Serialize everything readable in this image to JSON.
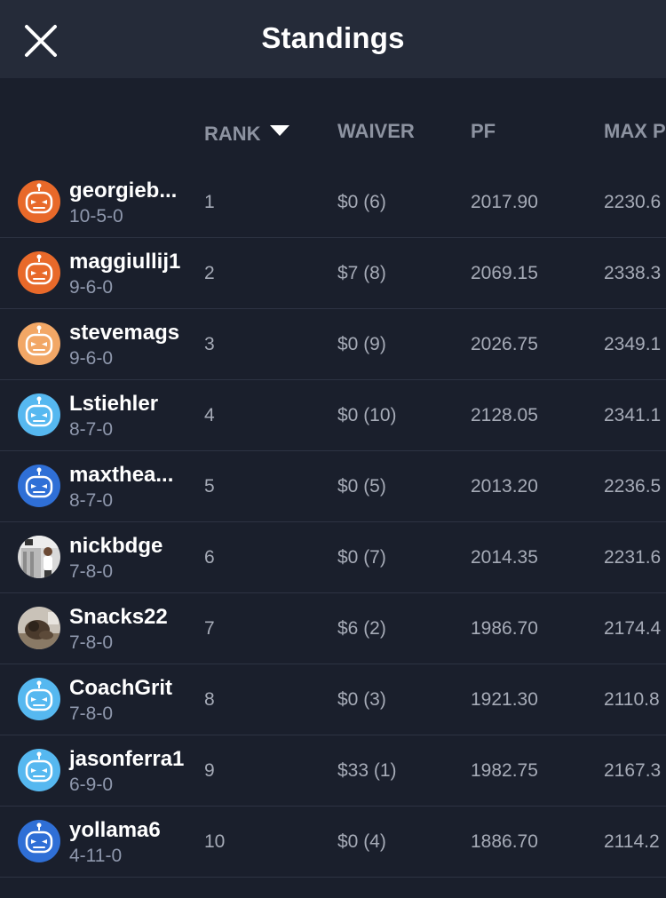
{
  "header": {
    "title": "Standings",
    "close_icon": "close-icon"
  },
  "columns": {
    "rank": "RANK",
    "waiver": "WAIVER",
    "pf": "PF",
    "max": "MAX P"
  },
  "colors": {
    "bot_orange": "#e8692a",
    "bot_peach": "#f2a766",
    "bot_lightblue": "#56b8f0",
    "bot_blue": "#2f6fd6"
  },
  "standings": [
    {
      "name": "georgieb...",
      "record": "10-5-0",
      "rank": "1",
      "waiver": "$0 (6)",
      "pf": "2017.90",
      "max": "2230.6",
      "avatar": "robot-orange"
    },
    {
      "name": "maggiullij1",
      "record": "9-6-0",
      "rank": "2",
      "waiver": "$7 (8)",
      "pf": "2069.15",
      "max": "2338.3",
      "avatar": "robot-orange"
    },
    {
      "name": "stevemags",
      "record": "9-6-0",
      "rank": "3",
      "waiver": "$0 (9)",
      "pf": "2026.75",
      "max": "2349.1",
      "avatar": "robot-peach"
    },
    {
      "name": "Lstiehler",
      "record": "8-7-0",
      "rank": "4",
      "waiver": "$0 (10)",
      "pf": "2128.05",
      "max": "2341.1",
      "avatar": "robot-lightblue"
    },
    {
      "name": "maxthea...",
      "record": "8-7-0",
      "rank": "5",
      "waiver": "$0 (5)",
      "pf": "2013.20",
      "max": "2236.5",
      "avatar": "robot-blue"
    },
    {
      "name": "nickbdge",
      "record": "7-8-0",
      "rank": "6",
      "waiver": "$0 (7)",
      "pf": "2014.35",
      "max": "2231.6",
      "avatar": "photo-person"
    },
    {
      "name": "Snacks22",
      "record": "7-8-0",
      "rank": "7",
      "waiver": "$6 (2)",
      "pf": "1986.70",
      "max": "2174.4",
      "avatar": "photo-dog"
    },
    {
      "name": "CoachGrit",
      "record": "7-8-0",
      "rank": "8",
      "waiver": "$0 (3)",
      "pf": "1921.30",
      "max": "2110.8",
      "avatar": "robot-lightblue"
    },
    {
      "name": "jasonferra1",
      "record": "6-9-0",
      "rank": "9",
      "waiver": "$33 (1)",
      "pf": "1982.75",
      "max": "2167.3",
      "avatar": "robot-lightblue"
    },
    {
      "name": "yollama6",
      "record": "4-11-0",
      "rank": "10",
      "waiver": "$0 (4)",
      "pf": "1886.70",
      "max": "2114.2",
      "avatar": "robot-blue"
    }
  ]
}
